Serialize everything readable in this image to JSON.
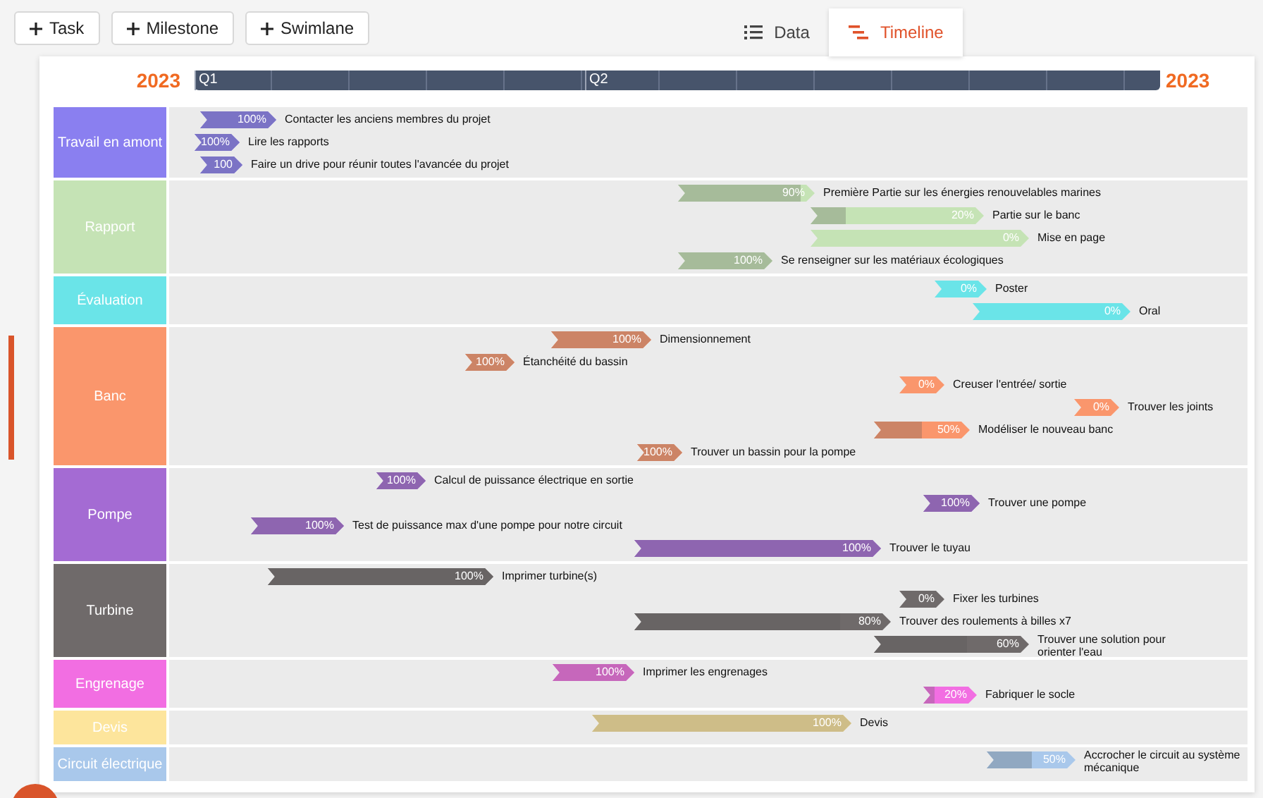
{
  "toolbar": {
    "buttons": [
      {
        "label": "Task"
      },
      {
        "label": "Milestone"
      },
      {
        "label": "Swimlane"
      }
    ]
  },
  "view_tabs": [
    {
      "label": "Data",
      "kind": "data",
      "selected": false
    },
    {
      "label": "Timeline",
      "kind": "timeline",
      "selected": true
    }
  ],
  "timeline": {
    "year_start": "2023",
    "year_end": "2023",
    "quarters": [
      "Q1",
      "Q2"
    ],
    "swimlanes": [
      {
        "name": "Travail en amont",
        "color": "#8a7ff0",
        "tasks": [
          {
            "label": "Contacter les anciens membres du projet",
            "percent": "100%"
          },
          {
            "label": "Lire les rapports",
            "percent": "100%"
          },
          {
            "label": "Faire un drive pour réunir toutes l'avancée du projet",
            "percent": "100"
          }
        ]
      },
      {
        "name": "Rapport",
        "color": "#c5e3b5",
        "tasks": [
          {
            "label": "Première Partie sur les énergies renouvelables marines",
            "percent": "90%",
            "level": 0.9
          },
          {
            "label": "Partie sur le banc",
            "percent": "20%",
            "level": 0.2
          },
          {
            "label": "Mise en page",
            "percent": "0%",
            "level": 0
          },
          {
            "label": "Se renseigner sur les matériaux écologiques",
            "percent": "100%",
            "level": 1
          }
        ]
      },
      {
        "name": "Évaluation",
        "color": "#6ae4e8",
        "tasks": [
          {
            "label": "Poster",
            "percent": "0%",
            "level": 0
          },
          {
            "label": "Oral",
            "percent": "0%",
            "level": 0
          }
        ]
      },
      {
        "name": "Banc",
        "color": "#fa966c",
        "tasks": [
          {
            "label": "Dimensionnement",
            "percent": "100%",
            "level": 1
          },
          {
            "label": "Étanchéité du bassin",
            "percent": "100%",
            "level": 1
          },
          {
            "label": "Creuser l'entrée/ sortie",
            "percent": "0%",
            "level": 0
          },
          {
            "label": "Trouver les joints",
            "percent": "0%",
            "level": 0
          },
          {
            "label": "Modéliser le nouveau banc",
            "percent": "50%",
            "level": 0.5
          },
          {
            "label": "Trouver un bassin pour la pompe",
            "percent": "100%",
            "level": 1
          }
        ]
      },
      {
        "name": "Pompe",
        "color": "#a46bd3",
        "tasks": [
          {
            "label": "Calcul de puissance électrique en sortie",
            "percent": "100%",
            "level": 1
          },
          {
            "label": "Trouver une pompe",
            "percent": "100%",
            "level": 1
          },
          {
            "label": "Test de puissance max d'une pompe pour notre circuit",
            "percent": "100%",
            "level": 1
          },
          {
            "label": "Trouver le tuyau",
            "percent": "100%",
            "level": 1
          }
        ]
      },
      {
        "name": "Turbine",
        "color": "#6f6a6a",
        "tasks": [
          {
            "label": "Imprimer turbine(s)",
            "percent": "100%",
            "level": 1
          },
          {
            "label": "Fixer les turbines",
            "percent": "0%",
            "level": 0
          },
          {
            "label": "Trouver des roulements à billes x7",
            "percent": "80%",
            "level": 0.8
          },
          {
            "label": "Trouver une solution pour orienter l'eau",
            "percent": "60%",
            "level": 0.6
          }
        ]
      },
      {
        "name": "Engrenage",
        "color": "#f26ee2",
        "tasks": [
          {
            "label": "Imprimer les engrenages",
            "percent": "100%",
            "level": 1
          },
          {
            "label": "Fabriquer le socle",
            "percent": "20%",
            "level": 0.2
          }
        ]
      },
      {
        "name": "Devis",
        "color": "#fde59c",
        "tasks": [
          {
            "label": "Devis",
            "percent": "100%",
            "level": 1
          }
        ]
      },
      {
        "name": "Circuit électrique",
        "color": "#a9c8eb",
        "tasks": [
          {
            "label": "Accrocher le circuit au système mécanique",
            "percent": "50%",
            "level": 0.5
          }
        ]
      }
    ]
  }
}
